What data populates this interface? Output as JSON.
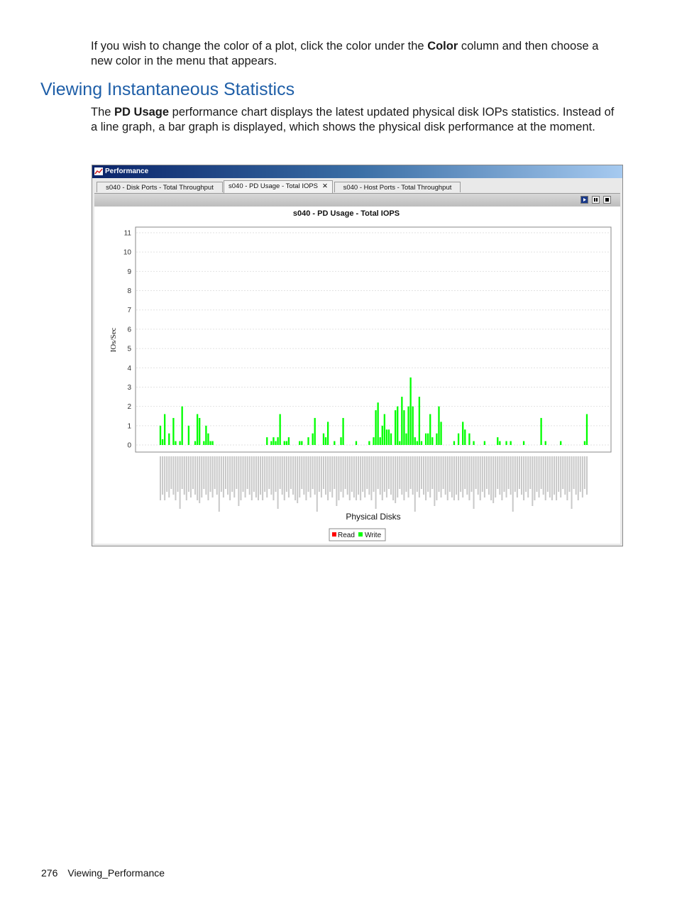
{
  "intro": {
    "text_before": "If you wish to change the color of a plot, click the color under the ",
    "bold": "Color",
    "text_after": " column and then choose a new color in the menu that appears."
  },
  "heading": "Viewing Instantaneous Statistics",
  "body": {
    "text_before": "The ",
    "bold": "PD Usage",
    "text_after": " performance chart displays the latest updated physical disk IOPs statistics. Instead of a line graph, a bar graph is displayed, which shows the physical disk performance at the moment."
  },
  "window": {
    "title": "Performance",
    "tabs": [
      {
        "label": "s040 - Disk Ports - Total Throughput",
        "active": false
      },
      {
        "label": "s040 - PD Usage - Total IOPS",
        "active": true,
        "close": "✕"
      },
      {
        "label": "s040 - Host Ports - Total Throughput",
        "active": false
      }
    ],
    "toolbar_icons": [
      "play-icon",
      "pause-icon",
      "stop-icon"
    ]
  },
  "chart_data": {
    "type": "bar",
    "title": "s040 - PD Usage - Total IOPS",
    "xlabel": "Physical Disks",
    "ylabel": "IOs/Sec",
    "ylim": [
      0,
      11
    ],
    "yticks": [
      0,
      1,
      2,
      3,
      4,
      5,
      6,
      7,
      8,
      9,
      10,
      11
    ],
    "grid": true,
    "legend": {
      "placement": "bottom-center",
      "entries": [
        {
          "name": "Read",
          "color": "#ff0000"
        },
        {
          "name": "Write",
          "color": "#00ff00"
        }
      ]
    },
    "series": [
      {
        "name": "Read",
        "color": "#ff0000",
        "values": []
      },
      {
        "name": "Write",
        "color": "#00ff00",
        "values": [
          1.0,
          0.3,
          1.6,
          0,
          0.6,
          0,
          1.4,
          0.2,
          0,
          0.2,
          2.0,
          0,
          0,
          1.0,
          0,
          0,
          0.2,
          1.6,
          1.4,
          0,
          0.2,
          1.0,
          0.6,
          0.2,
          0.2,
          0,
          0,
          0,
          0,
          0,
          0,
          0,
          0,
          0,
          0,
          0,
          0,
          0,
          0,
          0,
          0,
          0,
          0,
          0,
          0,
          0,
          0,
          0,
          0,
          0.4,
          0,
          0.2,
          0.4,
          0.2,
          0.4,
          1.6,
          0,
          0.2,
          0.2,
          0.4,
          0,
          0,
          0,
          0,
          0.2,
          0.2,
          0,
          0,
          0.4,
          0,
          0.6,
          1.4,
          0,
          0,
          0,
          0.6,
          0.4,
          1.2,
          0,
          0,
          0.2,
          0,
          0,
          0.4,
          1.4,
          0,
          0,
          0,
          0,
          0,
          0.2,
          0,
          0,
          0,
          0,
          0,
          0.2,
          0,
          0.4,
          1.8,
          2.2,
          0.4,
          1.0,
          1.6,
          0.8,
          0.8,
          0.6,
          0,
          1.8,
          2.0,
          0.2,
          2.5,
          1.8,
          0.6,
          2.0,
          3.5,
          2.0,
          0.4,
          0.2,
          2.5,
          0.2,
          0,
          0.6,
          0.6,
          1.6,
          0.4,
          0,
          0.6,
          2.0,
          1.2,
          0,
          0,
          0,
          0,
          0,
          0.2,
          0,
          0.6,
          0,
          1.2,
          0.8,
          0,
          0.6,
          0,
          0.2,
          0,
          0,
          0,
          0,
          0.2,
          0,
          0,
          0,
          0,
          0,
          0.4,
          0.2,
          0,
          0,
          0.2,
          0,
          0.2,
          0,
          0,
          0,
          0,
          0,
          0.2,
          0,
          0,
          0,
          0,
          0,
          0,
          0,
          1.4,
          0,
          0.2,
          0,
          0,
          0,
          0,
          0,
          0,
          0.2,
          0,
          0,
          0,
          0,
          0,
          0,
          0,
          0,
          0,
          0,
          0.2,
          1.6
        ]
      }
    ]
  },
  "footer": {
    "page_number": "276",
    "section": "Viewing_Performance"
  }
}
